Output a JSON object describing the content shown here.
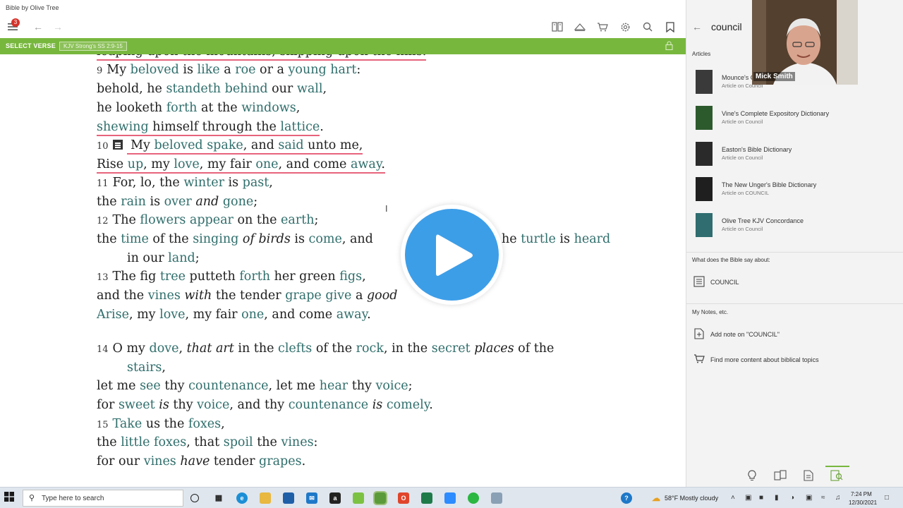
{
  "window": {
    "title": "Bible by Olive Tree"
  },
  "toolbar": {
    "menu_badge": "3"
  },
  "greenbar": {
    "select_verse": "SELECT VERSE",
    "resource_chip": "KJV Strong's SS 2:9-15"
  },
  "reader": {
    "top_cut": "leaping upon the mountains, skipping upon the hills.",
    "v9": {
      "num": "9",
      "l1": [
        "My ",
        "beloved",
        " is ",
        "like",
        " a ",
        "roe",
        " or a ",
        "young hart",
        ":"
      ],
      "l2": [
        "behold, he ",
        "standeth",
        " ",
        "behind",
        " our ",
        "wall",
        ","
      ],
      "l3": [
        "he looketh ",
        "forth",
        " at the ",
        "windows",
        ","
      ],
      "l4": [
        "shewing",
        " himself through the ",
        "lattice",
        "."
      ]
    },
    "v10": {
      "num": "10",
      "l1": [
        " My ",
        "beloved",
        " ",
        "spake",
        ", and ",
        "said",
        " unto me,"
      ],
      "l2": [
        "Rise ",
        "up",
        ", my ",
        "love",
        ", my fair ",
        "one",
        ", and come ",
        "away",
        "."
      ]
    },
    "v11": {
      "num": "11",
      "l1": [
        "For, lo, the ",
        "winter",
        " is ",
        "past",
        ","
      ],
      "l2": [
        "the ",
        "rain",
        " is ",
        "over",
        " ",
        "and",
        " ",
        "gone",
        ";"
      ]
    },
    "v12": {
      "num": "12",
      "l1": [
        "The ",
        "flowers",
        " ",
        "appear",
        " on the ",
        "earth",
        ";"
      ],
      "l2a": [
        "the ",
        "time",
        " of the ",
        "singing",
        " ",
        "of birds",
        " is ",
        "come",
        ", and"
      ],
      "l2b": [
        "he ",
        "turtle",
        " is ",
        "heard"
      ],
      "l3": [
        "in our ",
        "land",
        ";"
      ]
    },
    "v13": {
      "num": "13",
      "l1": [
        "The fig ",
        "tree",
        " putteth ",
        "forth",
        " her green ",
        "figs",
        ","
      ],
      "l2": [
        "and the ",
        "vines",
        " ",
        "with",
        " the tender ",
        "grape",
        " ",
        "give",
        " a ",
        "good"
      ],
      "l3": [
        "Arise",
        ", my ",
        "love",
        ", my fair ",
        "one",
        ", and come ",
        "away",
        "."
      ]
    },
    "v14": {
      "num": "14",
      "l1": [
        "O my ",
        "dove",
        ", ",
        "that art",
        " in the ",
        "clefts",
        " of the ",
        "rock",
        ", in the ",
        "secret",
        " ",
        "places",
        " of the"
      ],
      "l2": [
        "stairs",
        ","
      ],
      "l3": [
        "let me ",
        "see",
        " thy ",
        "countenance",
        ", let me ",
        "hear",
        " thy ",
        "voice",
        ";"
      ],
      "l4": [
        "for ",
        "sweet",
        " ",
        "is",
        " thy ",
        "voice",
        ", and thy ",
        "countenance",
        " ",
        "is",
        " ",
        "comely",
        "."
      ]
    },
    "v15": {
      "num": "15",
      "l1": [
        "Take",
        " us the ",
        "foxes",
        ","
      ],
      "l2": [
        "the ",
        "little",
        " ",
        "foxes",
        ", that ",
        "spoil",
        " the ",
        "vines",
        ":"
      ],
      "l3": [
        "for our ",
        "vines",
        " ",
        "have",
        " tender ",
        "grapes",
        "."
      ]
    }
  },
  "sidebar": {
    "query": "council",
    "articles_header": "Articles",
    "articles": [
      {
        "title": "Mounce's C",
        "subtitle": "Article on Council",
        "color": "#3a3a3a"
      },
      {
        "title": "Vine's Complete Expository Dictionary",
        "subtitle": "Article on Council",
        "color": "#2d5a2d"
      },
      {
        "title": "Easton's Bible Dictionary",
        "subtitle": "Article on Council",
        "color": "#2a2a2a"
      },
      {
        "title": "The New Unger's Bible Dictionary",
        "subtitle": "Article on COUNCIL",
        "color": "#1f1f1f"
      },
      {
        "title": "Olive Tree KJV Concordance",
        "subtitle": "Article on Council",
        "color": "#2f6d70"
      }
    ],
    "bible_says_header": "What does the Bible say about:",
    "topic": "COUNCIL",
    "notes_header": "My Notes, etc.",
    "add_note": "Add note on \"COUNCIL\"",
    "find_more": "Find more content about biblical topics"
  },
  "webcam": {
    "name": "Mick Smith"
  },
  "taskbar": {
    "search_placeholder": "Type here to search",
    "weather": "58°F  Mostly cloudy",
    "time": "7:24 PM",
    "date": "12/30/2021"
  },
  "colors": {
    "accent_green": "#78b73e",
    "word_teal": "#2f6e6b",
    "underline_pink": "#e8637c",
    "play_blue": "#3d9ee8"
  }
}
